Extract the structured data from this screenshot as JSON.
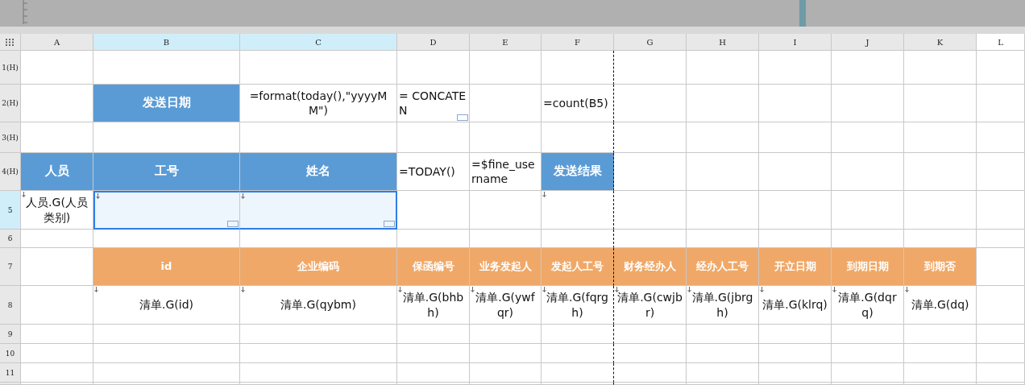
{
  "columns": [
    {
      "label": "A",
      "selected": false,
      "kind": "used",
      "page_break": false
    },
    {
      "label": "B",
      "selected": true,
      "kind": "used",
      "page_break": false
    },
    {
      "label": "C",
      "selected": true,
      "kind": "used",
      "page_break": false
    },
    {
      "label": "D",
      "selected": false,
      "kind": "used",
      "page_break": false
    },
    {
      "label": "E",
      "selected": false,
      "kind": "used",
      "page_break": false
    },
    {
      "label": "F",
      "selected": false,
      "kind": "used",
      "page_break": true
    },
    {
      "label": "G",
      "selected": false,
      "kind": "used",
      "page_break": false
    },
    {
      "label": "H",
      "selected": false,
      "kind": "used",
      "page_break": false
    },
    {
      "label": "I",
      "selected": false,
      "kind": "used",
      "page_break": false
    },
    {
      "label": "J",
      "selected": false,
      "kind": "used",
      "page_break": false
    },
    {
      "label": "K",
      "selected": false,
      "kind": "used",
      "page_break": false
    },
    {
      "label": "L",
      "selected": false,
      "kind": "outside",
      "page_break": false
    }
  ],
  "rows": [
    {
      "header": "1(H)",
      "selected": false,
      "cells": [
        null,
        null,
        null,
        null,
        null,
        null,
        null,
        null,
        null,
        null,
        null,
        null
      ]
    },
    {
      "header": "2(H)",
      "selected": false,
      "cells": [
        null,
        {
          "text": "发送日期",
          "kind": "blue"
        },
        {
          "text": "=format(today(),\"yyyyMM\")",
          "kind": "plain"
        },
        {
          "text": "= CONCATEN",
          "kind": "left",
          "corner_box": true
        },
        null,
        {
          "text": "=count(B5)",
          "kind": "left"
        },
        null,
        null,
        null,
        null,
        null,
        null
      ]
    },
    {
      "header": "3(H)",
      "selected": false,
      "cells": [
        null,
        null,
        null,
        null,
        null,
        null,
        null,
        null,
        null,
        null,
        null,
        null
      ]
    },
    {
      "header": "4(H)",
      "selected": false,
      "cells": [
        {
          "text": "人员",
          "kind": "blue"
        },
        {
          "text": "工号",
          "kind": "blue"
        },
        {
          "text": "姓名",
          "kind": "blue"
        },
        {
          "text": "=TODAY()",
          "kind": "left"
        },
        {
          "text": "=$fine_username",
          "kind": "left"
        },
        {
          "text": "发送结果",
          "kind": "blue"
        },
        null,
        null,
        null,
        null,
        null,
        null
      ]
    },
    {
      "header": "5",
      "selected": true,
      "cells": [
        {
          "text": "人员.G(人员类别)",
          "kind": "plain",
          "expand": true
        },
        {
          "kind": "plain",
          "expand": true,
          "corner_box": true,
          "selected": true
        },
        {
          "kind": "plain",
          "expand": true,
          "corner_box": true,
          "selected": true
        },
        null,
        null,
        {
          "kind": "plain",
          "expand": true
        },
        null,
        null,
        null,
        null,
        null,
        null
      ]
    },
    {
      "header": "6",
      "selected": false,
      "cells": [
        null,
        null,
        null,
        null,
        null,
        null,
        null,
        null,
        null,
        null,
        null,
        null
      ]
    },
    {
      "header": "7",
      "selected": false,
      "cells": [
        null,
        {
          "text": "id",
          "kind": "orange"
        },
        {
          "text": "企业编码",
          "kind": "orange"
        },
        {
          "text": "保函编号",
          "kind": "orange"
        },
        {
          "text": "业务发起人",
          "kind": "orange"
        },
        {
          "text": "发起人工号",
          "kind": "orange"
        },
        {
          "text": "财务经办人",
          "kind": "orange"
        },
        {
          "text": "经办人工号",
          "kind": "orange"
        },
        {
          "text": "开立日期",
          "kind": "orange"
        },
        {
          "text": "到期日期",
          "kind": "orange"
        },
        {
          "text": "到期否",
          "kind": "orange"
        },
        null
      ]
    },
    {
      "header": "8",
      "selected": false,
      "cells": [
        null,
        {
          "text": "清单.G(id)",
          "kind": "plain",
          "expand": true
        },
        {
          "text": "清单.G(qybm)",
          "kind": "plain",
          "expand": true
        },
        {
          "text": "清单.G(bhbh)",
          "kind": "plain",
          "expand": true
        },
        {
          "text": "清单.G(ywfqr)",
          "kind": "plain",
          "expand": true
        },
        {
          "text": "清单.G(fqrgh)",
          "kind": "plain",
          "expand": true
        },
        {
          "text": "清单.G(cwjbr)",
          "kind": "plain",
          "expand": true
        },
        {
          "text": "清单.G(jbrgh)",
          "kind": "plain",
          "expand": true
        },
        {
          "text": "清单.G(klrq)",
          "kind": "plain",
          "expand": true
        },
        {
          "text": "清单.G(dqrq)",
          "kind": "plain",
          "expand": true
        },
        {
          "text": "清单.G(dq)",
          "kind": "plain",
          "expand": true
        },
        null
      ]
    },
    {
      "header": "9",
      "selected": false,
      "cells": [
        null,
        null,
        null,
        null,
        null,
        null,
        null,
        null,
        null,
        null,
        null,
        null
      ]
    },
    {
      "header": "10",
      "selected": false,
      "cells": [
        null,
        null,
        null,
        null,
        null,
        null,
        null,
        null,
        null,
        null,
        null,
        null
      ]
    },
    {
      "header": "11",
      "selected": false,
      "cells": [
        null,
        null,
        null,
        null,
        null,
        null,
        null,
        null,
        null,
        null,
        null,
        null
      ]
    }
  ]
}
